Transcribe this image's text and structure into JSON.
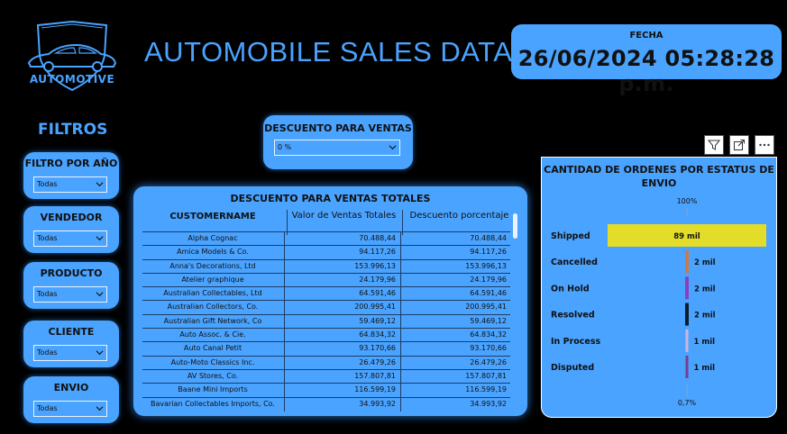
{
  "header": {
    "logo_text": "AUTOMOTIVE",
    "title": "AUTOMOBILE SALES DATA",
    "date_label": "FECHA",
    "date_value": "26/06/2024 05:28:28 p.m."
  },
  "filters": {
    "title": "FILTROS",
    "items": [
      {
        "label": "FILTRO POR AÑO",
        "value": "Todas"
      },
      {
        "label": "VENDEDOR",
        "value": "Todas"
      },
      {
        "label": "PRODUCTO",
        "value": "Todas"
      },
      {
        "label": "CLIENTE",
        "value": "Todas"
      },
      {
        "label": "ENVIO",
        "value": "Todas"
      }
    ]
  },
  "discount_filter": {
    "label": "DESCUENTO PARA VENTAS",
    "value": "0 %"
  },
  "sales_table": {
    "title": "DESCUENTO PARA VENTAS TOTALES",
    "columns": [
      "CUSTOMERNAME",
      "Valor de Ventas Totales",
      "Descuento porcentaje"
    ],
    "rows": [
      [
        "Alpha Cognac",
        "70.488,44",
        "70.488,44"
      ],
      [
        "Amica Models & Co.",
        "94.117,26",
        "94.117,26"
      ],
      [
        "Anna's Decorations, Ltd",
        "153.996,13",
        "153.996,13"
      ],
      [
        "Atelier graphique",
        "24.179,96",
        "24.179,96"
      ],
      [
        "Australian Collectables, Ltd",
        "64.591,46",
        "64.591,46"
      ],
      [
        "Australian Collectors, Co.",
        "200.995,41",
        "200.995,41"
      ],
      [
        "Australian Gift Network, Co",
        "59.469,12",
        "59.469,12"
      ],
      [
        "Auto Assoc. & Cie.",
        "64.834,32",
        "64.834,32"
      ],
      [
        "Auto Canal Petit",
        "93.170,66",
        "93.170,66"
      ],
      [
        "Auto-Moto Classics Inc.",
        "26.479,26",
        "26.479,26"
      ],
      [
        "AV Stores, Co.",
        "157.807,81",
        "157.807,81"
      ],
      [
        "Baane Mini Imports",
        "116.599,19",
        "116.599,19"
      ],
      [
        "Bavarian Collectables Imports, Co.",
        "34.993,92",
        "34.993,92"
      ]
    ]
  },
  "visual_toolbar": {
    "icons": [
      "filter-icon",
      "focus-mode-icon",
      "more-options-icon"
    ]
  },
  "chart_data": {
    "type": "bar",
    "orientation": "horizontal",
    "title": "CANTIDAD DE ORDENES POR ESTATUS DE ENVIO",
    "top_label": "100%",
    "bottom_label": "0,7%",
    "categories": [
      "Shipped",
      "Cancelled",
      "On Hold",
      "Resolved",
      "In Process",
      "Disputed"
    ],
    "values": [
      89,
      2,
      2,
      2,
      1,
      1
    ],
    "value_labels": [
      "89 mil",
      "2 mil",
      "2 mil",
      "2 mil",
      "1 mil",
      "1 mil"
    ],
    "colors": [
      "#e3dd2a",
      "#c97a4a",
      "#8a3fbf",
      "#0d1b2a",
      "#c9b8e0",
      "#7a3f8f"
    ],
    "xlim": [
      0,
      89
    ]
  }
}
